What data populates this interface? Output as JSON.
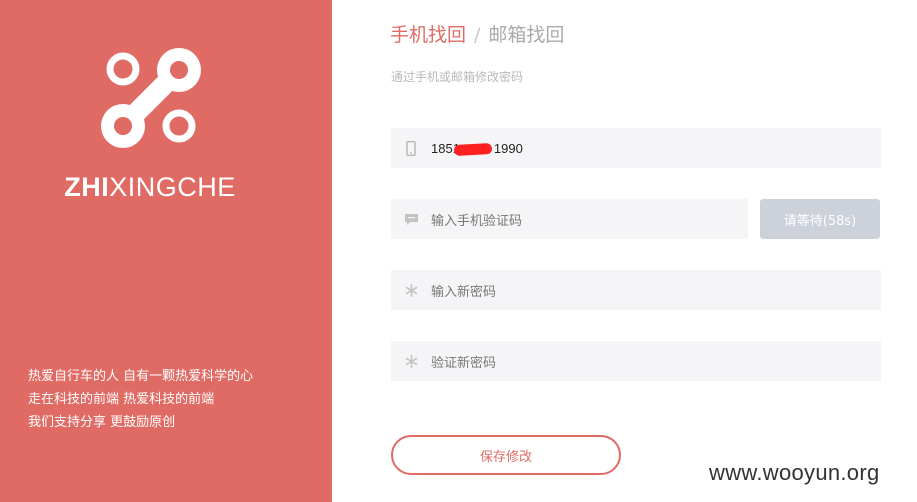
{
  "brand": {
    "name_bold": "ZHI",
    "name_rest": "XINGCHE",
    "color": "#e06b64"
  },
  "slogan": [
    "热爱自行车的人 自有一颗热爱科学的心",
    "走在科技的前端 热爱科技的前端",
    "我们支持分享 更鼓励原创"
  ],
  "tabs": {
    "phone": "手机找回",
    "separator": "/",
    "email": "邮箱找回"
  },
  "subtitle": "通过手机或邮箱修改密码",
  "form": {
    "phone_value": "1851█████1990",
    "phone_prefix": "1851",
    "phone_suffix": "1990",
    "code_placeholder": "输入手机验证码",
    "wait_button": "请等待(58s)",
    "new_password_placeholder": "输入新密码",
    "confirm_password_placeholder": "验证新密码",
    "save_button": "保存修改"
  },
  "watermark": "www.wooyun.org",
  "icons": {
    "phone": "mobile-phone-icon",
    "code": "chat-bubble-icon",
    "password": "asterisk-icon"
  }
}
